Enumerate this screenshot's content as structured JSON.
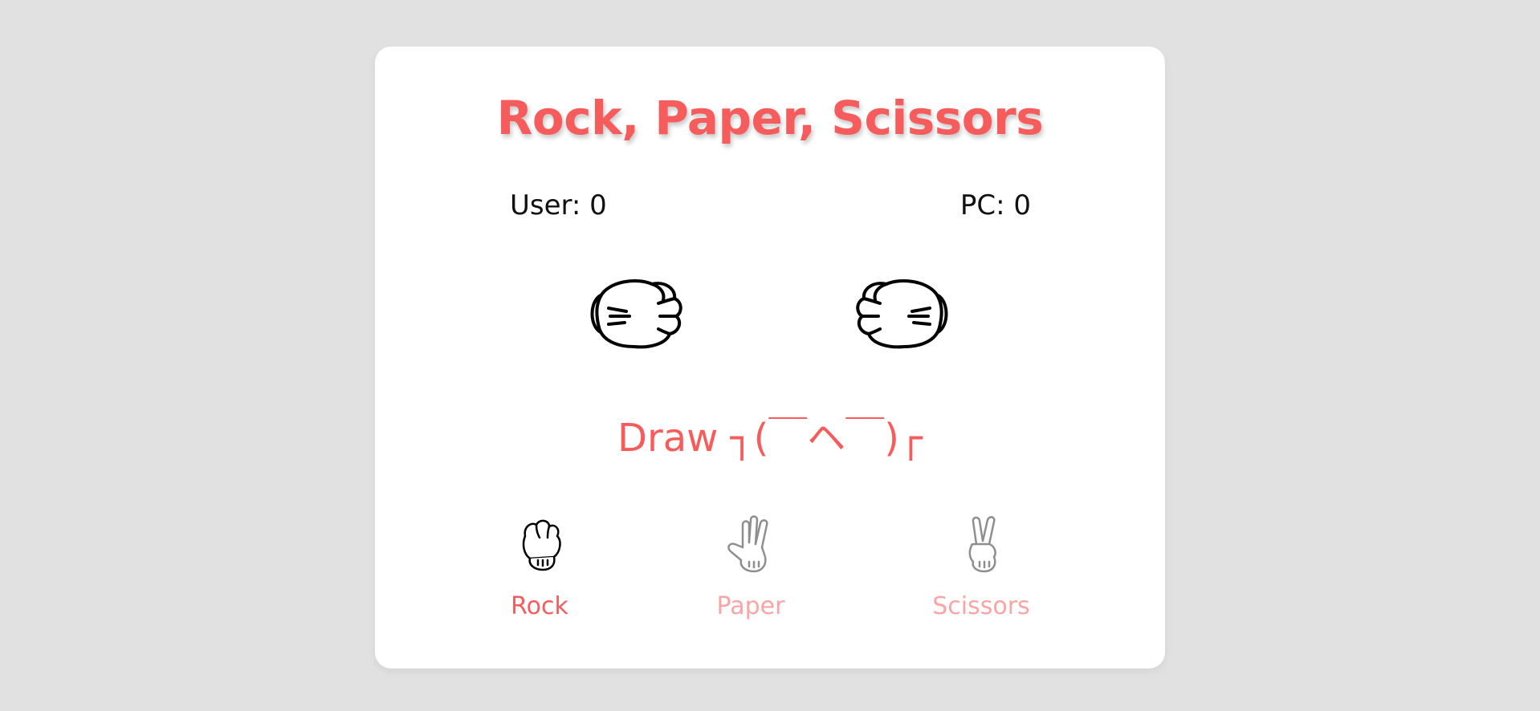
{
  "title": "Rock, Paper, Scissors",
  "score": {
    "user": "User: 0",
    "pc": "PC: 0"
  },
  "hands": {
    "user": "fist-icon",
    "pc": "fist-icon"
  },
  "result": "Draw ┐(￣ヘ￣)┌",
  "choices": [
    {
      "label": "Rock",
      "icon": "rock-hand-icon",
      "selected": true
    },
    {
      "label": "Paper",
      "icon": "paper-hand-icon",
      "selected": false
    },
    {
      "label": "Scissors",
      "icon": "scissors-hand-icon",
      "selected": false
    }
  ],
  "colors": {
    "accent": "#f75c5c",
    "accent_dim": "#f9a5a5",
    "background": "#e1e1e1",
    "card": "#ffffff"
  }
}
